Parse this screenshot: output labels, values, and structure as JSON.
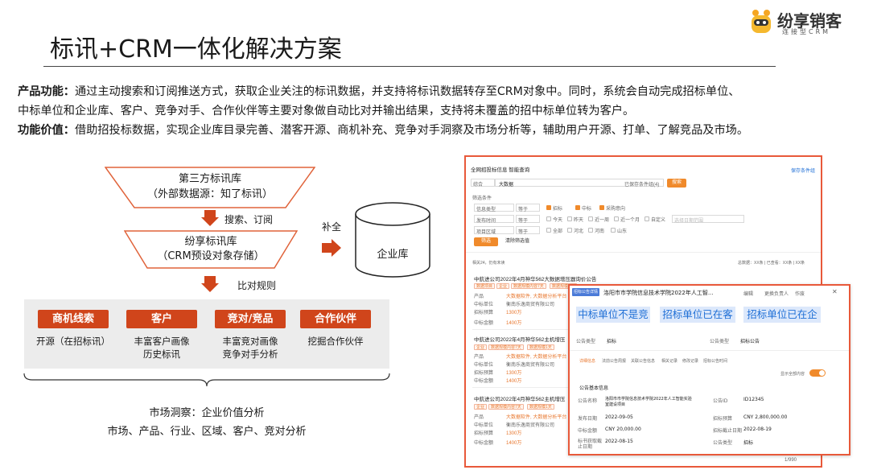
{
  "header": {
    "title": "标讯+CRM一体化解决方案",
    "logo_name": "纷享销客",
    "logo_sub": "连接型CRM"
  },
  "description": {
    "feature_label": "产品功能：",
    "feature_line1": "通过主动搜索和订阅推送方式，获取企业关注的标讯数据，并支持将标讯数据转存至CRM对象中。同时，系统会自动完成招标单位、",
    "feature_line2": "中标单位和企业库、客户、竞争对手、合作伙伴等主要对象做自动比对并输出结果，支持将未覆盖的招中标单位转为客户。",
    "value_label": "功能价值：",
    "value_line": "借助招投标数据，实现企业库目录完善、潜客开源、商机补充、竞争对手洞察及市场分析等，辅助用户开源、打单、了解竞品及市场。"
  },
  "flow": {
    "source_line1": "第三方标讯库",
    "source_line2": "（外部数据源：知了标讯）",
    "step1_label": "搜索、订阅",
    "store_line1": "纷享标讯库",
    "store_line2": "（CRM预设对象存储）",
    "step2_label": "比对规则",
    "supplement_label": "补全",
    "enterprise_db": "企业库",
    "objects": [
      {
        "tag": "商机线索",
        "desc1": "开源（在招标讯）",
        "desc2": ""
      },
      {
        "tag": "客户",
        "desc1": "丰富客户画像",
        "desc2": "历史标讯"
      },
      {
        "tag": "竞对/竞品",
        "desc1": "丰富竞对画像",
        "desc2": "竞争对手分析"
      },
      {
        "tag": "合作伙伴",
        "desc1": "挖掘合作伙伴",
        "desc2": ""
      }
    ],
    "market_title": "市场洞察：企业价值分析",
    "market_sub": "市场、产品、行业、区域、客户、竞对分析"
  },
  "screenshot": {
    "tab_title": "全网招投标信息  智能查询",
    "save_link": "保存条件组",
    "select_type": "综合",
    "search_value": "大数据",
    "saved_conditions": "已保存条件组(4)",
    "search_btn": "搜索",
    "filter_label": "筛选条件",
    "rows": [
      {
        "label": "信息类型",
        "op": "等于",
        "opts": [
          "招标",
          "中标",
          "采购意向"
        ]
      },
      {
        "label": "发布时间",
        "op": "等于",
        "opts": [
          "今天",
          "昨天",
          "近一周",
          "近一个月",
          "自定义"
        ]
      },
      {
        "label": "项目区域",
        "op": "等于",
        "opts": [
          "全部",
          "河北",
          "河南",
          "山东"
        ]
      }
    ],
    "date_placeholder": "选择日期范围",
    "filter_btn": "筛选",
    "clear_btn": "清除筛选值",
    "result_count": "相关24，仍有未读",
    "result_meta": "总数据：XX条 | 已查看：XX条 | XX条",
    "results": [
      {
        "title": "中航进公司2022年4月神华562大数据增压器询价公告",
        "tags": [
          "数据项目",
          "企业",
          "数据规模内容7天",
          "数据规模1天"
        ],
        "fields": [
          "产品",
          "中标单位",
          "招标预算",
          "中标金额"
        ],
        "values": [
          "大数据软件, 大数据分析平台",
          "衡南乐逸商贸有限公司",
          "1300万",
          "1400万"
        ]
      },
      {
        "title": "中航进公司2022年4月神华562主机增压",
        "tags": [
          "企业",
          "数据规模内容7天",
          "数据规模1天"
        ],
        "fields": [
          "产品",
          "中标单位",
          "招标预算",
          "中标金额"
        ],
        "values": [
          "大数据软件, 大数据分析平台",
          "衡南乐逸商贸有限公司",
          "1300万",
          "1400万"
        ]
      },
      {
        "title": "中航进公司2022年4月神华562主机增压",
        "tags": [
          "企业",
          "数据规模内容7天",
          "数据规模1天"
        ],
        "fields": [
          "产品",
          "中标单位",
          "招标预算",
          "中标金额"
        ],
        "values": [
          "大数据软件, 大数据分析平台",
          "衡南乐逸商贸有限公司",
          "1300万",
          "1400万"
        ]
      }
    ],
    "pagination": "1/990"
  },
  "popup": {
    "badge": "招标公告详情",
    "title": "洛阳市市学院信息技术学院2022年人工智...",
    "actions": [
      "编辑",
      "更换负责人",
      "作废"
    ],
    "chips": [
      "中标单位不是竞",
      "招标单位已在客",
      "招标单位已在企"
    ],
    "info_row": [
      {
        "label": "公告类型",
        "value": "招标"
      },
      {
        "label": "公告类型",
        "value": "招标公告"
      }
    ],
    "tabs": [
      "详细信息",
      "法前公告周报",
      "关联公告信息",
      "相关记录",
      "修改记录",
      "招标公告时间"
    ],
    "toggle_label": "显示全部内容",
    "section": "公告基本信息",
    "details": [
      {
        "l1": "公告名称",
        "v1": "洛阳市市学院信息技术学院2022年人工智能实验室建设项目",
        "l2": "公告ID",
        "v2": "ID12345"
      },
      {
        "l1": "发布日期",
        "v1": "2022-09-05",
        "l2": "招标预算",
        "v2": "CNY 2,800,000.00"
      },
      {
        "l1": "中标金额",
        "v1": "CNY 20,000.00",
        "l2": "招标截止日期",
        "v2": "2022-08-19"
      },
      {
        "l1": "标书获取截止日期",
        "v1": "2022-08-15",
        "l2": "公告类型",
        "v2": "招标"
      }
    ]
  },
  "colors": {
    "accent": "#d0451b",
    "border": "#e8593a",
    "chip_bg": "#dce8fb",
    "chip_text": "#1f6fd6",
    "panel_bg": "#ececec"
  }
}
